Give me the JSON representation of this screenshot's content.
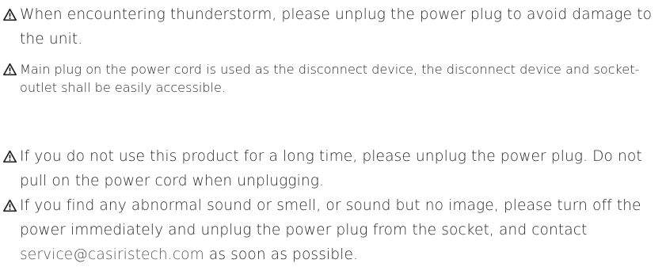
{
  "notices": [
    {
      "icon": "warning-triangle-icon",
      "text": "When encountering thunderstorm, please unplug the power plug to avoid damage to the unit."
    },
    {
      "icon": "warning-triangle-icon",
      "text": "Main plug on the power cord is used as the disconnect device, the disconnect device and socket-outlet shall be easily accessible."
    },
    {
      "icon": "warning-triangle-icon",
      "text": "If you do not use this product for a long time, please unplug the power plug. Do not pull on the power cord when unplugging."
    },
    {
      "icon": "warning-triangle-icon",
      "text_before_email": "If you find any abnormal sound or smell, or sound but no image, please turn off the power immediately and unplug the power plug from the socket, and contact ",
      "email": "service@casiristech.com",
      "text_after_email": " as soon as possible."
    }
  ]
}
